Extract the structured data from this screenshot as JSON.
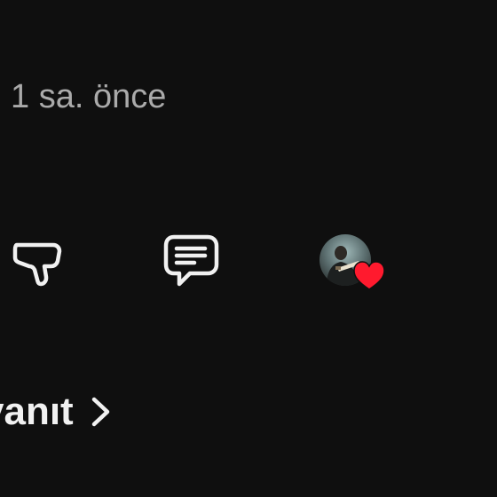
{
  "comment": {
    "timestamp": "1 sa. önce",
    "actions": {
      "dislike_icon": "thumbs-down-icon",
      "reply_icon": "comment-icon",
      "creator_heart": {
        "avatar_icon": "creator-avatar",
        "heart_icon": "heart-icon",
        "heart_color": "#ff1a2e"
      }
    },
    "replies_link": {
      "label": "vanıt",
      "chevron_icon": "chevron-right-icon"
    }
  },
  "colors": {
    "background": "#0f0f0f",
    "primary_text": "#f1f1f1",
    "secondary_text": "#aaaaaa"
  }
}
